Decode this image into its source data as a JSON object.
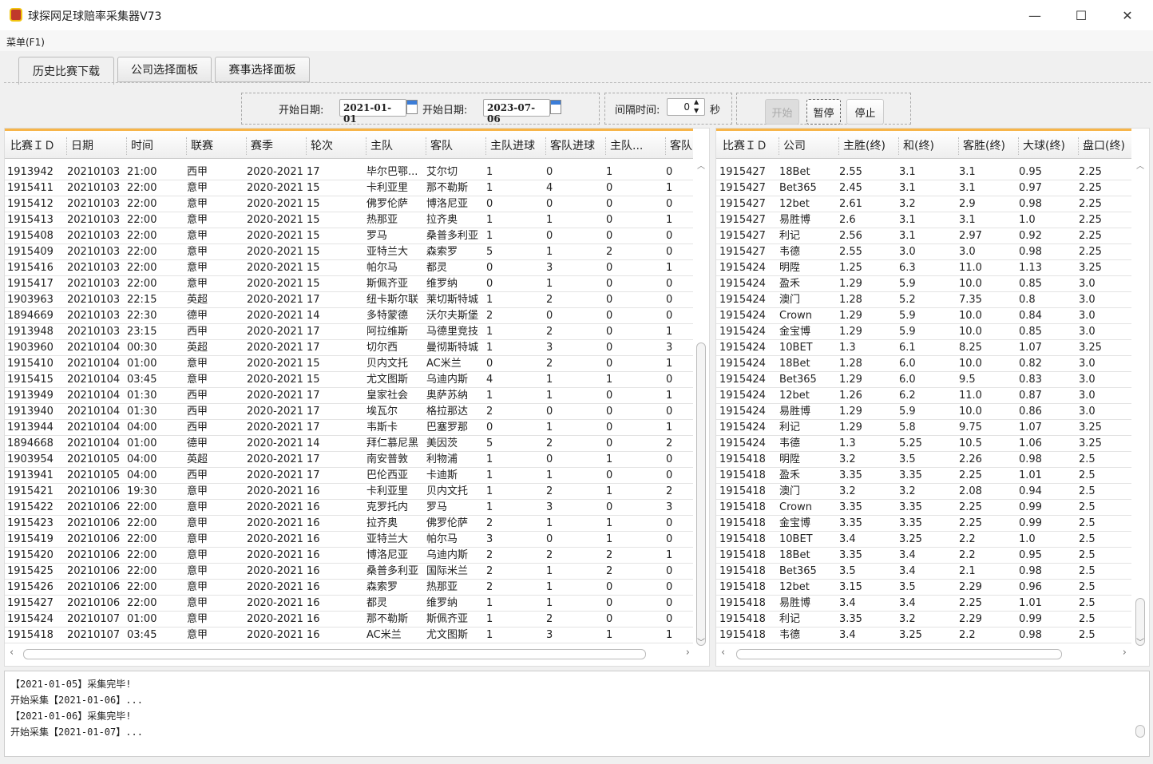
{
  "window": {
    "title": "球探网足球赔率采集器V73",
    "minimize": "—",
    "maximize": "☐",
    "close": "✕"
  },
  "menu": {
    "label": "菜单(F1)"
  },
  "tabs": [
    {
      "label": "历史比赛下载",
      "active": true
    },
    {
      "label": "公司选择面板"
    },
    {
      "label": "赛事选择面板"
    }
  ],
  "controls": {
    "start_date_label": "开始日期:",
    "start_date": "2021-01-01",
    "end_date_label": "开始日期:",
    "end_date": "2023-07-06",
    "interval_label": "间隔时间:",
    "interval_value": "0",
    "interval_unit": "秒",
    "start_button": "开始",
    "pause_button": "暂停",
    "stop_button": "停止"
  },
  "matches": {
    "columns": [
      "比赛ＩＤ",
      "日期",
      "时间",
      "联赛",
      "赛季",
      "轮次",
      "主队",
      "客队",
      "主队进球",
      "客队进球",
      "主队...",
      "客队"
    ],
    "rows": [
      [
        "1913942",
        "20210103",
        "21:00",
        "西甲",
        "2020-2021",
        "17",
        "毕尔巴鄂...",
        "艾尔切",
        "1",
        "0",
        "1",
        "0"
      ],
      [
        "1915411",
        "20210103",
        "22:00",
        "意甲",
        "2020-2021",
        "15",
        "卡利亚里",
        "那不勒斯",
        "1",
        "4",
        "0",
        "1"
      ],
      [
        "1915412",
        "20210103",
        "22:00",
        "意甲",
        "2020-2021",
        "15",
        "佛罗伦萨",
        "博洛尼亚",
        "0",
        "0",
        "0",
        "0"
      ],
      [
        "1915413",
        "20210103",
        "22:00",
        "意甲",
        "2020-2021",
        "15",
        "热那亚",
        "拉齐奥",
        "1",
        "1",
        "0",
        "1"
      ],
      [
        "1915408",
        "20210103",
        "22:00",
        "意甲",
        "2020-2021",
        "15",
        "罗马",
        "桑普多利亚",
        "1",
        "0",
        "0",
        "0"
      ],
      [
        "1915409",
        "20210103",
        "22:00",
        "意甲",
        "2020-2021",
        "15",
        "亚特兰大",
        "森索罗",
        "5",
        "1",
        "2",
        "0"
      ],
      [
        "1915416",
        "20210103",
        "22:00",
        "意甲",
        "2020-2021",
        "15",
        "帕尔马",
        "都灵",
        "0",
        "3",
        "0",
        "1"
      ],
      [
        "1915417",
        "20210103",
        "22:00",
        "意甲",
        "2020-2021",
        "15",
        "斯佩齐亚",
        "维罗纳",
        "0",
        "1",
        "0",
        "0"
      ],
      [
        "1903963",
        "20210103",
        "22:15",
        "英超",
        "2020-2021",
        "17",
        "纽卡斯尔联",
        "莱切斯特城",
        "1",
        "2",
        "0",
        "0"
      ],
      [
        "1894669",
        "20210103",
        "22:30",
        "德甲",
        "2020-2021",
        "14",
        "多特蒙德",
        "沃尔夫斯堡",
        "2",
        "0",
        "0",
        "0"
      ],
      [
        "1913948",
        "20210103",
        "23:15",
        "西甲",
        "2020-2021",
        "17",
        "阿拉维斯",
        "马德里竞技",
        "1",
        "2",
        "0",
        "1"
      ],
      [
        "1903960",
        "20210104",
        "00:30",
        "英超",
        "2020-2021",
        "17",
        "切尔西",
        "曼彻斯特城",
        "1",
        "3",
        "0",
        "3"
      ],
      [
        "1915410",
        "20210104",
        "01:00",
        "意甲",
        "2020-2021",
        "15",
        "贝内文托",
        "AC米兰",
        "0",
        "2",
        "0",
        "1"
      ],
      [
        "1915415",
        "20210104",
        "03:45",
        "意甲",
        "2020-2021",
        "15",
        "尤文图斯",
        "乌迪内斯",
        "4",
        "1",
        "1",
        "0"
      ],
      [
        "1913949",
        "20210104",
        "01:30",
        "西甲",
        "2020-2021",
        "17",
        "皇家社会",
        "奥萨苏纳",
        "1",
        "1",
        "0",
        "1"
      ],
      [
        "1913940",
        "20210104",
        "01:30",
        "西甲",
        "2020-2021",
        "17",
        "埃瓦尔",
        "格拉那达",
        "2",
        "0",
        "0",
        "0"
      ],
      [
        "1913944",
        "20210104",
        "04:00",
        "西甲",
        "2020-2021",
        "17",
        "韦斯卡",
        "巴塞罗那",
        "0",
        "1",
        "0",
        "1"
      ],
      [
        "1894668",
        "20210104",
        "01:00",
        "德甲",
        "2020-2021",
        "14",
        "拜仁慕尼黑",
        "美因茨",
        "5",
        "2",
        "0",
        "2"
      ],
      [
        "1903954",
        "20210105",
        "04:00",
        "英超",
        "2020-2021",
        "17",
        "南安普敦",
        "利物浦",
        "1",
        "0",
        "1",
        "0"
      ],
      [
        "1913941",
        "20210105",
        "04:00",
        "西甲",
        "2020-2021",
        "17",
        "巴伦西亚",
        "卡迪斯",
        "1",
        "1",
        "0",
        "0"
      ],
      [
        "1915421",
        "20210106",
        "19:30",
        "意甲",
        "2020-2021",
        "16",
        "卡利亚里",
        "贝内文托",
        "1",
        "2",
        "1",
        "2"
      ],
      [
        "1915422",
        "20210106",
        "22:00",
        "意甲",
        "2020-2021",
        "16",
        "克罗托内",
        "罗马",
        "1",
        "3",
        "0",
        "3"
      ],
      [
        "1915423",
        "20210106",
        "22:00",
        "意甲",
        "2020-2021",
        "16",
        "拉齐奥",
        "佛罗伦萨",
        "2",
        "1",
        "1",
        "0"
      ],
      [
        "1915419",
        "20210106",
        "22:00",
        "意甲",
        "2020-2021",
        "16",
        "亚特兰大",
        "帕尔马",
        "3",
        "0",
        "1",
        "0"
      ],
      [
        "1915420",
        "20210106",
        "22:00",
        "意甲",
        "2020-2021",
        "16",
        "博洛尼亚",
        "乌迪内斯",
        "2",
        "2",
        "2",
        "1"
      ],
      [
        "1915425",
        "20210106",
        "22:00",
        "意甲",
        "2020-2021",
        "16",
        "桑普多利亚",
        "国际米兰",
        "2",
        "1",
        "2",
        "0"
      ],
      [
        "1915426",
        "20210106",
        "22:00",
        "意甲",
        "2020-2021",
        "16",
        "森索罗",
        "热那亚",
        "2",
        "1",
        "0",
        "0"
      ],
      [
        "1915427",
        "20210106",
        "22:00",
        "意甲",
        "2020-2021",
        "16",
        "都灵",
        "维罗纳",
        "1",
        "1",
        "0",
        "0"
      ],
      [
        "1915424",
        "20210107",
        "01:00",
        "意甲",
        "2020-2021",
        "16",
        "那不勒斯",
        "斯佩齐亚",
        "1",
        "2",
        "0",
        "0"
      ],
      [
        "1915418",
        "20210107",
        "03:45",
        "意甲",
        "2020-2021",
        "16",
        "AC米兰",
        "尤文图斯",
        "1",
        "3",
        "1",
        "1"
      ]
    ]
  },
  "odds": {
    "columns": [
      "比赛ＩＤ",
      "公司",
      "主胜(终)",
      "和(终)",
      "客胜(终)",
      "大球(终)",
      "盘口(终)"
    ],
    "rows": [
      [
        "1915427",
        "18Bet",
        "2.55",
        "3.1",
        "3.1",
        "0.95",
        "2.25"
      ],
      [
        "1915427",
        "Bet365",
        "2.45",
        "3.1",
        "3.1",
        "0.97",
        "2.25"
      ],
      [
        "1915427",
        "12bet",
        "2.61",
        "3.2",
        "2.9",
        "0.98",
        "2.25"
      ],
      [
        "1915427",
        "易胜博",
        "2.6",
        "3.1",
        "3.1",
        "1.0",
        "2.25"
      ],
      [
        "1915427",
        "利记",
        "2.56",
        "3.1",
        "2.97",
        "0.92",
        "2.25"
      ],
      [
        "1915427",
        "韦德",
        "2.55",
        "3.0",
        "3.0",
        "0.98",
        "2.25"
      ],
      [
        "1915424",
        "明陞",
        "1.25",
        "6.3",
        "11.0",
        "1.13",
        "3.25"
      ],
      [
        "1915424",
        "盈禾",
        "1.29",
        "5.9",
        "10.0",
        "0.85",
        "3.0"
      ],
      [
        "1915424",
        "澳门",
        "1.28",
        "5.2",
        "7.35",
        "0.8",
        "3.0"
      ],
      [
        "1915424",
        "Crown",
        "1.29",
        "5.9",
        "10.0",
        "0.84",
        "3.0"
      ],
      [
        "1915424",
        "金宝博",
        "1.29",
        "5.9",
        "10.0",
        "0.85",
        "3.0"
      ],
      [
        "1915424",
        "10BET",
        "1.3",
        "6.1",
        "8.25",
        "1.07",
        "3.25"
      ],
      [
        "1915424",
        "18Bet",
        "1.28",
        "6.0",
        "10.0",
        "0.82",
        "3.0"
      ],
      [
        "1915424",
        "Bet365",
        "1.29",
        "6.0",
        "9.5",
        "0.83",
        "3.0"
      ],
      [
        "1915424",
        "12bet",
        "1.26",
        "6.2",
        "11.0",
        "0.87",
        "3.0"
      ],
      [
        "1915424",
        "易胜博",
        "1.29",
        "5.9",
        "10.0",
        "0.86",
        "3.0"
      ],
      [
        "1915424",
        "利记",
        "1.29",
        "5.8",
        "9.75",
        "1.07",
        "3.25"
      ],
      [
        "1915424",
        "韦德",
        "1.3",
        "5.25",
        "10.5",
        "1.06",
        "3.25"
      ],
      [
        "1915418",
        "明陞",
        "3.2",
        "3.5",
        "2.26",
        "0.98",
        "2.5"
      ],
      [
        "1915418",
        "盈禾",
        "3.35",
        "3.35",
        "2.25",
        "1.01",
        "2.5"
      ],
      [
        "1915418",
        "澳门",
        "3.2",
        "3.2",
        "2.08",
        "0.94",
        "2.5"
      ],
      [
        "1915418",
        "Crown",
        "3.35",
        "3.35",
        "2.25",
        "0.99",
        "2.5"
      ],
      [
        "1915418",
        "金宝博",
        "3.35",
        "3.35",
        "2.25",
        "0.99",
        "2.5"
      ],
      [
        "1915418",
        "10BET",
        "3.4",
        "3.25",
        "2.2",
        "1.0",
        "2.5"
      ],
      [
        "1915418",
        "18Bet",
        "3.35",
        "3.4",
        "2.2",
        "0.95",
        "2.5"
      ],
      [
        "1915418",
        "Bet365",
        "3.5",
        "3.4",
        "2.1",
        "0.98",
        "2.5"
      ],
      [
        "1915418",
        "12bet",
        "3.15",
        "3.5",
        "2.29",
        "0.96",
        "2.5"
      ],
      [
        "1915418",
        "易胜博",
        "3.4",
        "3.4",
        "2.25",
        "1.01",
        "2.5"
      ],
      [
        "1915418",
        "利记",
        "3.35",
        "3.2",
        "2.29",
        "0.99",
        "2.5"
      ],
      [
        "1915418",
        "韦德",
        "3.4",
        "3.25",
        "2.2",
        "0.98",
        "2.5"
      ]
    ]
  },
  "log": [
    "【2021-01-05】采集完毕!",
    "开始采集【2021-01-06】...",
    "【2021-01-06】采集完毕!",
    "开始采集【2021-01-07】..."
  ],
  "colors": {
    "accent": "#f7b54a"
  }
}
